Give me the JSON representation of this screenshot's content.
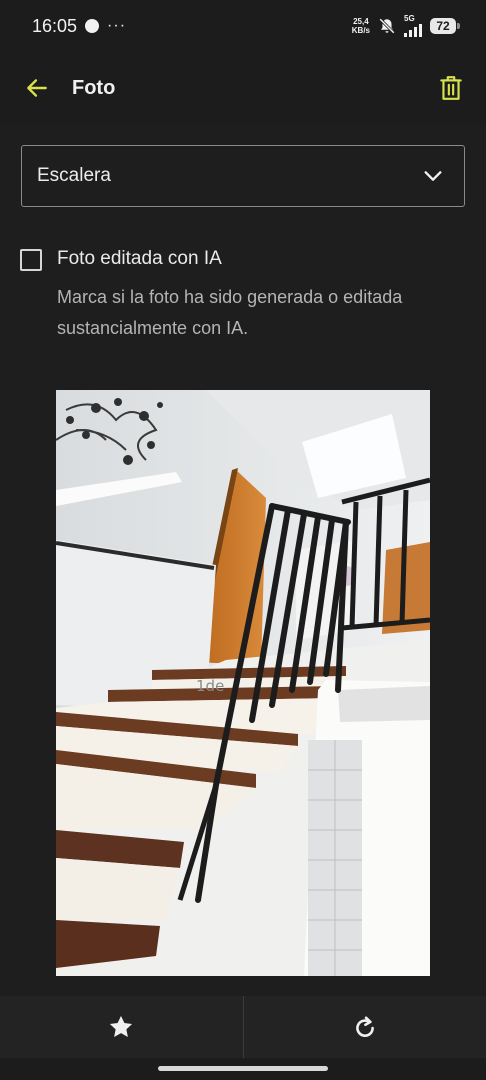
{
  "status_bar": {
    "time": "16:05",
    "more": "···",
    "speed_value": "25,4",
    "speed_unit": "KB/s",
    "network": "5G",
    "battery": "72"
  },
  "app_bar": {
    "title": "Foto",
    "accent_color": "#d7e34a"
  },
  "form": {
    "category_selected": "Escalera",
    "ai_checkbox": {
      "label": "Foto editada con IA",
      "help": "Marca si la foto ha sido generada o editada sustancialmente con IA.",
      "checked": false
    },
    "photo_sign_text": "1de"
  },
  "icons": {
    "back": "arrow-left-icon",
    "delete": "trash-icon",
    "dropdown": "chevron-down-icon",
    "favorite": "star-icon",
    "rotate": "rotate-icon"
  }
}
